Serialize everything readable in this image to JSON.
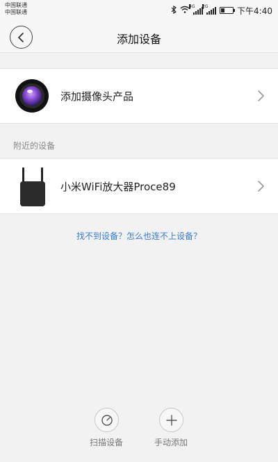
{
  "status_bar": {
    "carrier_1": "中国联通",
    "carrier_2": "中国联通",
    "signal_1_tag": "4G",
    "signal_2_tag": "2G",
    "bluetooth_icon": "bluetooth-icon",
    "wifi_icon": "wifi-icon",
    "battery_level": 0.3,
    "time": "下午4:40"
  },
  "header": {
    "back_icon": "chevron-left-icon",
    "title": "添加设备"
  },
  "camera_row": {
    "icon": "camera-lens-icon",
    "label": "添加摄像头产品"
  },
  "nearby": {
    "section_label": "附近的设备",
    "devices": [
      {
        "icon": "wifi-extender-icon",
        "label": "小米WiFi放大器Proce89"
      }
    ]
  },
  "help_link": "找不到设备？怎么也连不上设备？",
  "bottom_actions": [
    {
      "icon": "scan-icon",
      "label": "扫描设备"
    },
    {
      "icon": "plus-icon",
      "label": "手动添加"
    }
  ],
  "colors": {
    "background": "#f2f2f2",
    "link": "#3a7bd5",
    "text": "#222222",
    "muted": "#888888"
  }
}
